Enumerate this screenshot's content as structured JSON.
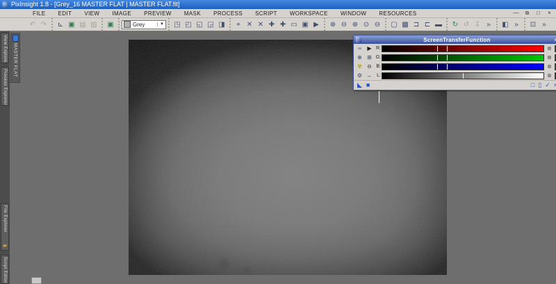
{
  "window": {
    "title": "PixInsight 1.8 - [Grey_16 MASTER FLAT | MASTER FLAT.fit]"
  },
  "menu": {
    "items": [
      "FILE",
      "EDIT",
      "VIEW",
      "IMAGE",
      "PREVIEW",
      "MASK",
      "PROCESS",
      "SCRIPT",
      "WORKSPACE",
      "WINDOW",
      "RESOURCES"
    ],
    "mdi_controls": [
      {
        "name": "minimize-icon",
        "glyph": "—"
      },
      {
        "name": "restore-icon",
        "glyph": "⧉"
      },
      {
        "name": "maximize-icon",
        "glyph": "□"
      },
      {
        "name": "close-icon",
        "glyph": "×"
      }
    ]
  },
  "toolbar": {
    "colorspace": {
      "value": "Grey",
      "swatch_color": "#b0b0b0"
    },
    "groups": [
      {
        "type": "icons",
        "items": [
          {
            "name": "undo-icon",
            "glyph": "↶",
            "disabled": true
          },
          {
            "name": "redo-icon",
            "glyph": "↷",
            "disabled": true
          }
        ]
      },
      {
        "type": "icons",
        "items": [
          {
            "name": "fit-view-icon",
            "glyph": "⊾"
          },
          {
            "name": "new-image-icon",
            "glyph": "▣",
            "color": "#2e7d4f"
          },
          {
            "name": "duplicate-image-icon",
            "glyph": "▤",
            "disabled": true
          },
          {
            "name": "iconize-image-icon",
            "glyph": "▥",
            "disabled": true
          }
        ]
      },
      {
        "type": "icons",
        "items": [
          {
            "name": "apply-stf-icon",
            "glyph": "▣",
            "color": "#2e7d4f"
          }
        ]
      },
      {
        "type": "select",
        "name": "colorspace-select"
      },
      {
        "type": "icons",
        "items": [
          {
            "name": "new-preview-icon",
            "glyph": "◳"
          },
          {
            "name": "preview-mode-icon",
            "glyph": "◰"
          },
          {
            "name": "edit-preview-icon",
            "glyph": "◱"
          },
          {
            "name": "delete-preview-icon",
            "glyph": "◲"
          },
          {
            "name": "preview-properties-icon",
            "glyph": "◨"
          }
        ]
      },
      {
        "type": "icons",
        "items": [
          {
            "name": "readout-mode-icon",
            "glyph": "⌖"
          },
          {
            "name": "expand-mode-icon",
            "glyph": "✕"
          },
          {
            "name": "contract-mode-icon",
            "glyph": "✕"
          },
          {
            "name": "pan-mode-icon",
            "glyph": "✚"
          },
          {
            "name": "scroll-mode-icon",
            "glyph": "✚"
          },
          {
            "name": "new-preview-mode-icon",
            "glyph": "▭"
          },
          {
            "name": "dynamic-view-icon",
            "glyph": "▣"
          },
          {
            "name": "select-mode-icon",
            "glyph": "▶"
          }
        ]
      },
      {
        "type": "icons",
        "items": [
          {
            "name": "zoom-in-icon",
            "glyph": "⊕"
          },
          {
            "name": "zoom-out-icon",
            "glyph": "⊖"
          },
          {
            "name": "zoom-in-mode-icon",
            "glyph": "⊕"
          },
          {
            "name": "zoom-11-icon",
            "glyph": "⊙"
          },
          {
            "name": "zoom-fit-icon",
            "glyph": "⊖"
          }
        ]
      },
      {
        "type": "icons",
        "items": [
          {
            "name": "define-preview-icon",
            "glyph": "▢"
          },
          {
            "name": "preview-from-selection-icon",
            "glyph": "▩"
          },
          {
            "name": "horizontal-profile-icon",
            "glyph": "⊐"
          },
          {
            "name": "vertical-profile-icon",
            "glyph": "⊏"
          },
          {
            "name": "mask-selection-icon",
            "glyph": "▬"
          }
        ]
      },
      {
        "type": "icons",
        "items": [
          {
            "name": "update-view-icon",
            "glyph": "↻",
            "color": "#2e7d4f"
          },
          {
            "name": "update-previews-icon",
            "glyph": "↺",
            "disabled": true
          },
          {
            "name": "update-all-icon",
            "glyph": "↧",
            "disabled": true
          },
          {
            "name": "overflow-chevron-icon",
            "glyph": "»"
          }
        ]
      },
      {
        "type": "icons",
        "items": [
          {
            "name": "background-toggle-icon",
            "glyph": "◧"
          },
          {
            "name": "overflow-chevron-icon",
            "glyph": "»"
          }
        ]
      },
      {
        "type": "icons",
        "items": [
          {
            "name": "screen-icon",
            "glyph": "⊡"
          },
          {
            "name": "overflow-chevron-icon",
            "glyph": "»"
          }
        ]
      }
    ]
  },
  "sidebar": {
    "tabs": [
      {
        "label": "View Explorer",
        "icon": {
          "name": "view-explorer-icon",
          "glyph": "■",
          "color": "#3f7ad1"
        }
      },
      {
        "label": "Process Explorer",
        "icon": {
          "name": "process-explorer-icon",
          "glyph": "⚙",
          "color": "#cfcfcf"
        }
      },
      {
        "label": "File Explorer",
        "icon": {
          "name": "file-explorer-icon",
          "glyph": "▰",
          "color": "#d2a63a"
        }
      },
      {
        "label": "Script Editor",
        "icon": {
          "name": "script-editor-icon",
          "glyph": "▰",
          "color": "#1db584"
        }
      }
    ]
  },
  "workspace": {
    "image_tab_label": "MASTER FLAT"
  },
  "stf": {
    "title": "ScreenTransferFunction",
    "close_glyph": "×",
    "reset_glyph": "⊗",
    "channels": [
      {
        "label": "R:",
        "end_color": "#ff0000",
        "markers": [
          0.34,
          0.4
        ],
        "tools": [
          {
            "name": "link-rgb-icon",
            "glyph": "∞",
            "color": "#4a5a9a"
          },
          {
            "name": "edit-mode-pointer-icon",
            "glyph": "▶",
            "color": "#111111"
          }
        ]
      },
      {
        "label": "G:",
        "end_color": "#00c800",
        "markers": [
          0.34,
          0.4
        ],
        "tools": [
          {
            "name": "zoom-in-icon",
            "glyph": "⊕",
            "color": "#3a4668"
          },
          {
            "name": "zoom-selection-icon",
            "glyph": "⊞",
            "color": "#3a4668"
          }
        ]
      },
      {
        "label": "B:",
        "end_color": "#0000ff",
        "markers": [
          0.34,
          0.4
        ],
        "tools": [
          {
            "name": "auto-stretch-icon",
            "glyph": "☢",
            "color": "#ad9a00"
          },
          {
            "name": "zoom-out-icon",
            "glyph": "⊖",
            "color": "#3a4668"
          }
        ]
      },
      {
        "label": "L:",
        "end_color": "#ffffff",
        "markers": [
          0.5
        ],
        "tools": [
          {
            "name": "settings-wrench-icon",
            "glyph": "⚙",
            "color": "#3a4668"
          },
          {
            "name": "shadows-range-icon",
            "glyph": "↔",
            "color": "#3a4668"
          }
        ]
      }
    ],
    "bottom_left_icons": [
      {
        "name": "new-instance-drag-icon",
        "glyph": "◣",
        "color": "#2b50c8"
      },
      {
        "name": "track-view-toggle-icon",
        "glyph": "■",
        "color": "#2b50c8"
      }
    ],
    "bottom_right_icons": [
      {
        "name": "reset-button-icon",
        "glyph": "□"
      },
      {
        "name": "new-instance-doc-icon",
        "glyph": "▯"
      },
      {
        "name": "apply-check-icon",
        "glyph": "✓"
      },
      {
        "name": "cancel-x-icon",
        "glyph": "×"
      }
    ]
  },
  "colors": {
    "titlebar_blue": "#1c5fbe",
    "chrome_grey": "#d6d3ce",
    "workspace_grey": "#6e6e6e",
    "stf_title_blue": "#39509c",
    "accent_blue": "#2b50c8"
  }
}
